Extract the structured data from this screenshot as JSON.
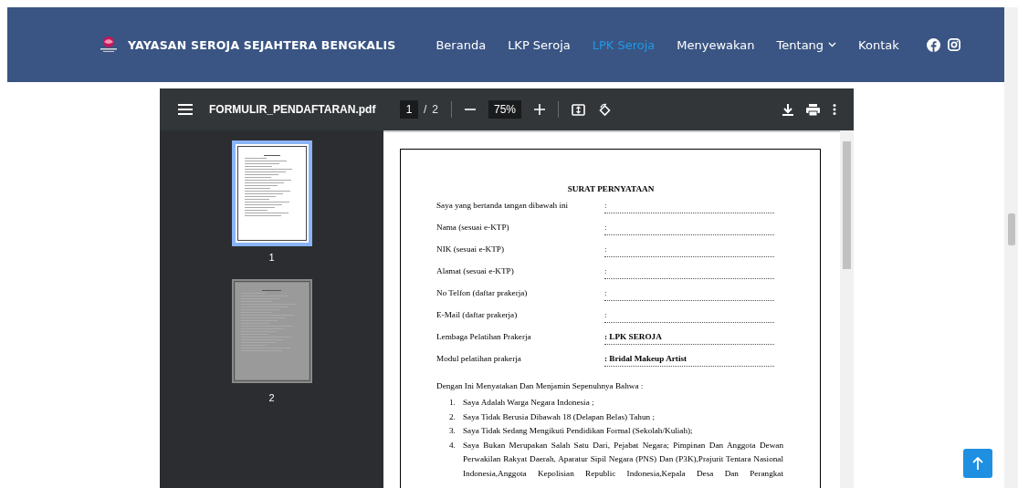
{
  "site": {
    "title": "YAYASAN SEROJA SEJAHTERA BENGKALIS",
    "nav": [
      {
        "label": "Beranda",
        "selected": false,
        "kind": "link"
      },
      {
        "label": "LKP Seroja",
        "selected": false,
        "kind": "link"
      },
      {
        "label": "LPK Seroja",
        "selected": true,
        "kind": "link"
      },
      {
        "label": "Menyewakan",
        "selected": false,
        "kind": "link"
      },
      {
        "label": "Tentang",
        "selected": false,
        "kind": "dropdown"
      },
      {
        "label": "Kontak",
        "selected": false,
        "kind": "link"
      }
    ]
  },
  "viewer": {
    "file_name": "FORMULIR_PENDAFTARAN.pdf",
    "current_page": "1",
    "page_separator": "/",
    "total_pages": "2",
    "zoom": "75%",
    "thumbnails": [
      {
        "label": "1",
        "selected": true
      },
      {
        "label": "2",
        "selected": false
      }
    ]
  },
  "document": {
    "title": "SURAT PERNYATAAN",
    "fields": [
      {
        "label": "Saya yang bertanda tangan dibawah ini",
        "value": ":",
        "bold": false
      },
      {
        "label": "Nama (sesuai e-KTP)",
        "value": ":",
        "bold": false
      },
      {
        "label": "NIK (sesuai e-KTP)",
        "value": ":",
        "bold": false
      },
      {
        "label": "Alamat (sesuai e-KTP)",
        "value": ":",
        "bold": false
      },
      {
        "label": "No Telfon (daftar prakerja)",
        "value": ":",
        "bold": false
      },
      {
        "label": "E-Mail (daftar prakerja)",
        "value": ":",
        "bold": false
      },
      {
        "label": "Lembaga Pelatihan Prakerja",
        "value": ": LPK SEROJA",
        "bold": true
      },
      {
        "label": "Modul pelatihan prakerja",
        "value": ": Bridal Makeup Artist",
        "bold": true
      }
    ],
    "intro": "Dengan Ini Menyatakan Dan Menjamin Sepenuhnya Bahwa :",
    "statements": [
      {
        "number": "1.",
        "text": "Saya Adalah Warga Negara Indonesia ;"
      },
      {
        "number": "2.",
        "text": "Saya Tidak Berusia Dibawah 18 (Delapan Belas) Tahun ;"
      },
      {
        "number": "3.",
        "text": "Saya Tidak Sedang Mengikuti Pendidikan Formal (Sekolah/Kuliah);"
      },
      {
        "number": "4.",
        "text": "Saya Bukan Merupakan Salah Satu Dari, Pejabat Negara; Pimpinan Dan Anggota Dewan Perwakilan Rakyat Daerah, Aparatur Sipil Negara (PNS) Dan (P3K),Prajurit Tentara Nasional Indonesia,Anggota Kepolisian Republic Indonesia,Kepala Desa Dan Perangkat"
      }
    ]
  }
}
